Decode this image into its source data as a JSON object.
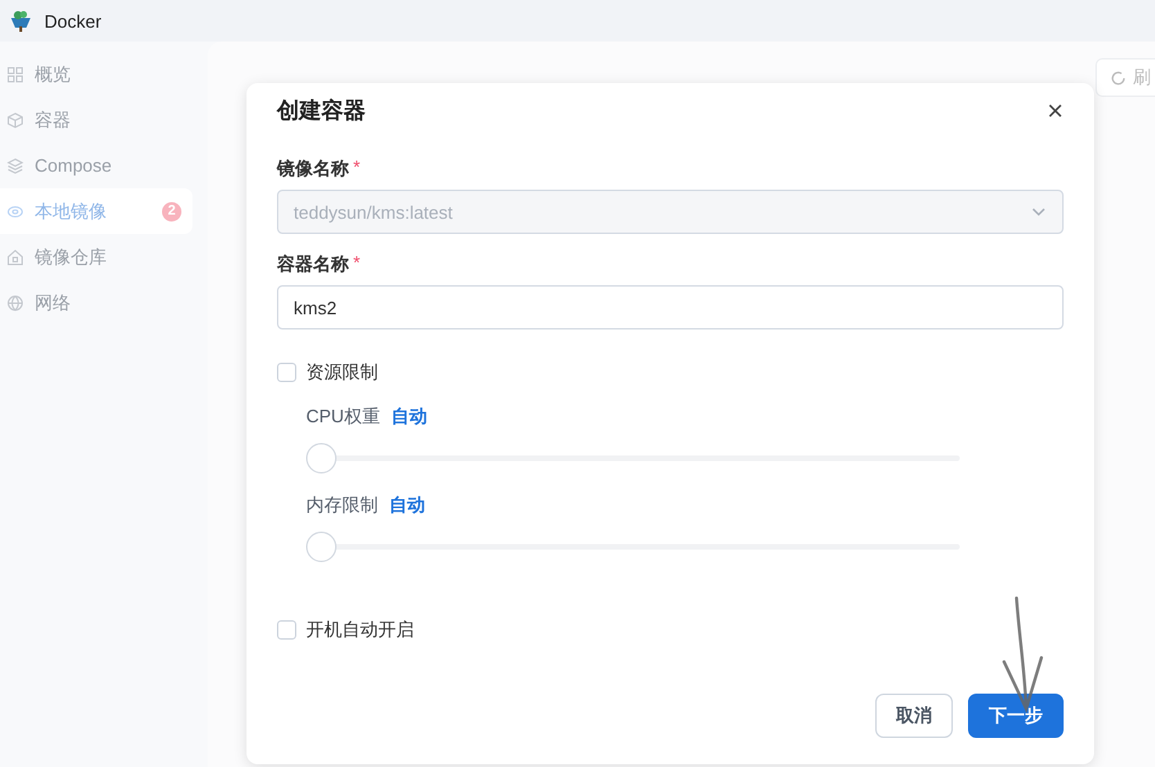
{
  "app": {
    "title": "Docker"
  },
  "sidebar": {
    "items": [
      {
        "kind": "grid",
        "label": "概览",
        "selected": false
      },
      {
        "kind": "cube",
        "label": "容器",
        "selected": false
      },
      {
        "kind": "layers",
        "label": "Compose",
        "selected": false
      },
      {
        "kind": "disk",
        "label": "本地镜像",
        "selected": true,
        "badge": "2"
      },
      {
        "kind": "house",
        "label": "镜像仓库",
        "selected": false
      },
      {
        "kind": "globe",
        "label": "网络",
        "selected": false
      }
    ]
  },
  "toolbar": {
    "refresh_label": "刷"
  },
  "dialog": {
    "title": "创建容器",
    "fields": [
      {
        "label": "镜像名称",
        "required_mark": "*",
        "value": "teddysun/kms:latest",
        "disabled": true,
        "kind": "select"
      },
      {
        "label": "容器名称",
        "required_mark": "*",
        "value": "kms2",
        "disabled": false,
        "kind": "input"
      }
    ],
    "resource_limit": {
      "label": "资源限制",
      "checked": false
    },
    "sliders": [
      {
        "label": "CPU权重",
        "value_label": "自动",
        "level": 0
      },
      {
        "label": "内存限制",
        "value_label": "自动",
        "level": 0
      }
    ],
    "autostart": {
      "label": "开机自动开启",
      "checked": false
    },
    "buttons": [
      {
        "label": "取消",
        "kind": "secondary"
      },
      {
        "label": "下一步",
        "kind": "primary"
      }
    ]
  }
}
